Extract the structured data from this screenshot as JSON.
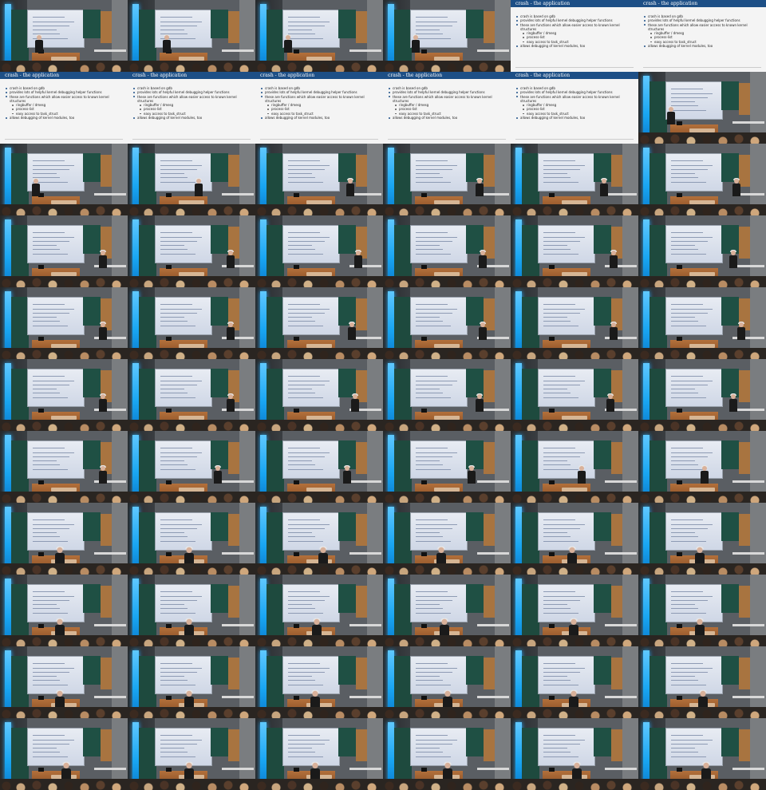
{
  "grid": {
    "columns": 6,
    "rows": 11
  },
  "slide": {
    "title": "crash - the application",
    "bullets": [
      {
        "text": "crash is based on gdb",
        "level": 1
      },
      {
        "text": "provides lots of helpful kernel debugging helper functions",
        "level": 1
      },
      {
        "text": "these are functions which allow easier access to known kernel structures",
        "level": 1
      },
      {
        "text": "ringbuffer / dmesg",
        "level": 2
      },
      {
        "text": "process-list",
        "level": 2
      },
      {
        "text": "easy access to task_struct",
        "level": 2
      },
      {
        "text": "allows debugging of kernel modules, too",
        "level": 1
      }
    ]
  },
  "frames": [
    "photo",
    "photo",
    "photo",
    "photo",
    "slide",
    "slide",
    "slide",
    "slide",
    "slide",
    "slide",
    "slide",
    "photo",
    "photo",
    "photo",
    "photo",
    "photo",
    "photo",
    "photo",
    "photo",
    "photo",
    "photo",
    "photo",
    "photo",
    "photo",
    "photo",
    "photo",
    "photo",
    "photo",
    "photo",
    "photo",
    "photo",
    "photo",
    "photo",
    "photo",
    "photo",
    "photo",
    "photo",
    "photo",
    "photo",
    "photo",
    "photo",
    "photo",
    "photo",
    "photo",
    "photo",
    "photo",
    "photo",
    "photo",
    "photo",
    "photo",
    "photo",
    "photo",
    "photo",
    "photo",
    "photo",
    "photo",
    "photo",
    "photo",
    "photo",
    "photo",
    "photo",
    "photo",
    "photo",
    "photo",
    "photo",
    "photo"
  ],
  "colors": {
    "stage_light": "#19a6f2",
    "slide_header": "#1d4f86",
    "desk": "#b3703b"
  }
}
